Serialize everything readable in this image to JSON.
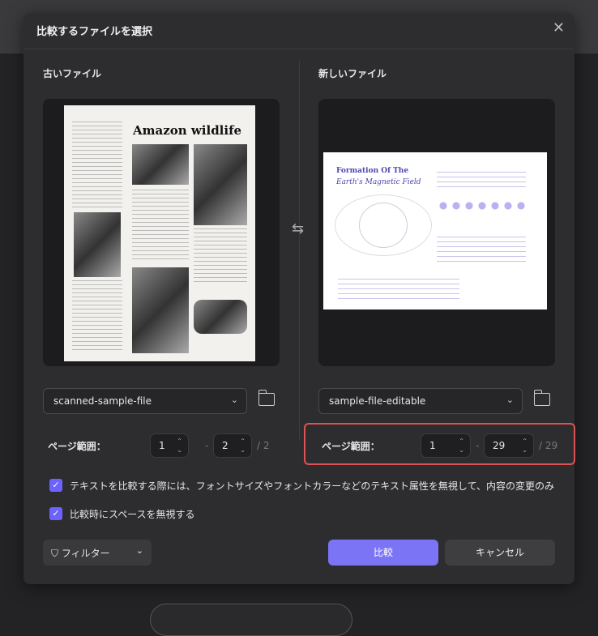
{
  "dialog": {
    "title": "比較するファイルを選択",
    "close_icon": "close-icon"
  },
  "old": {
    "label": "古いファイル",
    "file": "scanned-sample-file",
    "doc_title": "Amazon wildlife",
    "range_label": "ページ範囲：",
    "from": "1",
    "to": "2",
    "total": "/ 2"
  },
  "new": {
    "label": "新しいファイル",
    "file": "sample-file-editable",
    "doc_title_1": "Formation Of The",
    "doc_title_2": "Earth's Magnetic Field",
    "range_label": "ページ範囲：",
    "from": "1",
    "to": "29",
    "total": "/ 29"
  },
  "dash": "-",
  "options": [
    {
      "label": "テキストを比較する際には、フォントサイズやフォントカラーなどのテキスト属性を無視して、内容の変更のみ",
      "checked": true
    },
    {
      "label": "比較時にスペースを無視する",
      "checked": true
    }
  ],
  "footer": {
    "filter": "フィルター",
    "compare": "比較",
    "cancel": "キャンセル"
  },
  "colors": {
    "accent": "#7b74f5",
    "highlight": "#e05252"
  }
}
